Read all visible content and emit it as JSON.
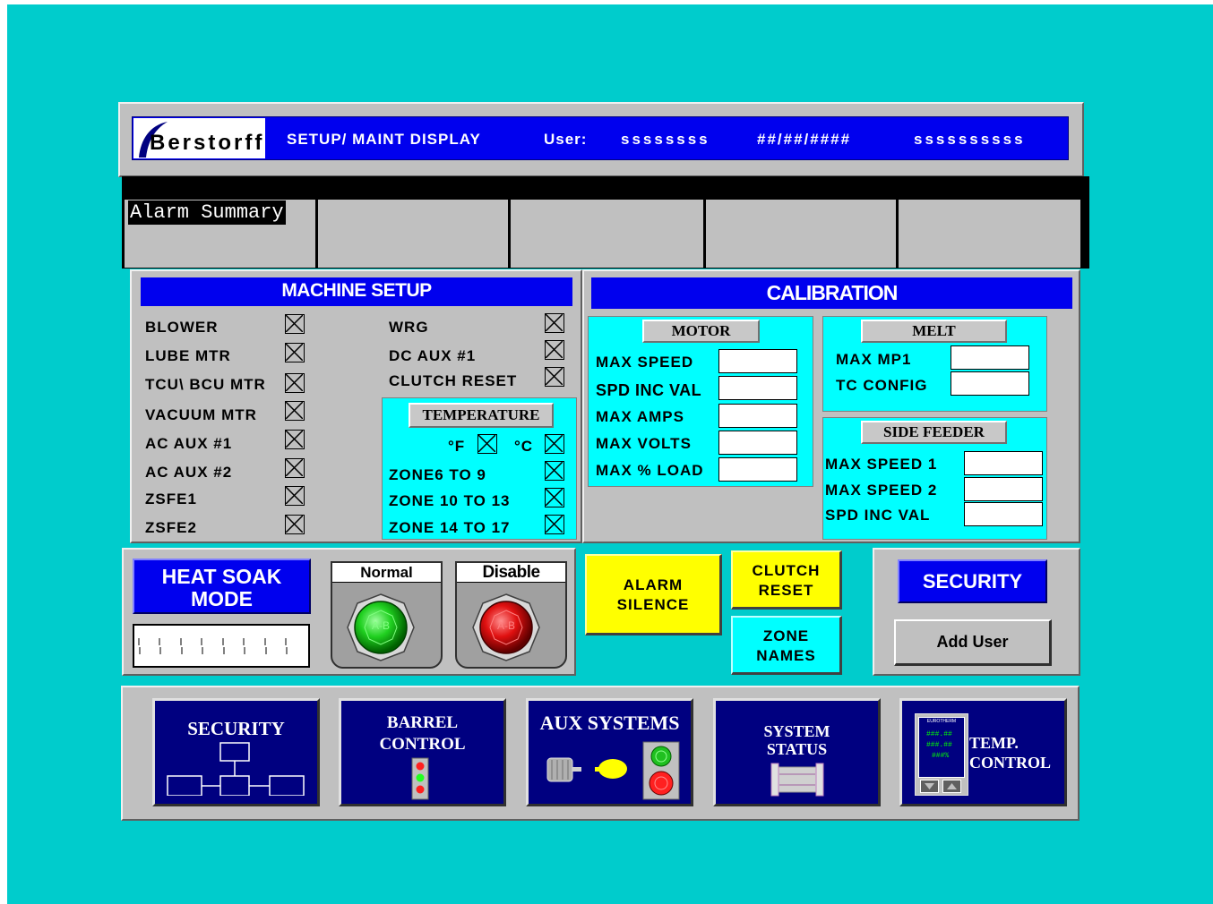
{
  "header": {
    "logo": "Berstorff",
    "title": "SETUP/ MAINT DISPLAY",
    "user_label": "User:",
    "user_value": "ssssssss",
    "date": "##/##/####",
    "status": "ssssssssss"
  },
  "alarm": {
    "label": "Alarm Summary"
  },
  "machine_setup": {
    "title": "MACHINE SETUP",
    "left_items": [
      "BLOWER",
      "LUBE MTR",
      "TCU\\ BCU MTR",
      "VACUUM MTR",
      "AC AUX #1",
      "AC AUX #2",
      "ZSFE1",
      "ZSFE2"
    ],
    "right_items": [
      "WRG",
      "DC AUX #1",
      "CLUTCH RESET"
    ]
  },
  "temperature": {
    "title": "TEMPERATURE",
    "unit_f": "°F",
    "unit_c": "°C",
    "zones": [
      "ZONE6 TO 9",
      "ZONE 10 TO 13",
      "ZONE 14 TO 17"
    ]
  },
  "calibration": {
    "title": "CALIBRATION",
    "motor": {
      "title": "MOTOR",
      "fields": [
        "MAX SPEED",
        "SPD INC  VAL",
        "MAX AMPS",
        "MAX VOLTS",
        "MAX % LOAD"
      ]
    },
    "melt": {
      "title": "MELT",
      "fields": [
        "MAX MP1",
        "TC CONFIG"
      ]
    },
    "side_feeder": {
      "title": "SIDE FEEDER",
      "fields": [
        "MAX SPEED 1",
        "MAX SPEED 2",
        "SPD INC VAL"
      ]
    }
  },
  "heat_soak": {
    "title_line1": "HEAT SOAK",
    "title_line2": "MODE",
    "normal_label": "Normal",
    "disable_label": "Disable",
    "button_text": "A-B"
  },
  "actions": {
    "alarm_silence_1": "ALARM",
    "alarm_silence_2": "SILENCE",
    "clutch_reset_1": "CLUTCH",
    "clutch_reset_2": "RESET",
    "zone_names_1": "ZONE",
    "zone_names_2": "NAMES"
  },
  "security_panel": {
    "title": "SECURITY",
    "add_user": "Add User"
  },
  "nav": {
    "security": "SECURITY",
    "barrel_1": "BARREL",
    "barrel_2": "CONTROL",
    "aux": "AUX SYSTEMS",
    "system_1": "SYSTEM",
    "system_2": "STATUS",
    "temp_1": "TEMP.",
    "temp_2": "CONTROL",
    "eurotherm": "EUROTHERM",
    "readout_1": "###.##",
    "readout_2": "###.##",
    "readout_3": "###%"
  },
  "colors": {
    "background": "#00cccc",
    "panel": "#c0c0c0",
    "title_bar": "#0000ee",
    "nav_button": "#000080",
    "highlight_yellow": "#ffff00",
    "highlight_cyan": "#00ffff"
  }
}
